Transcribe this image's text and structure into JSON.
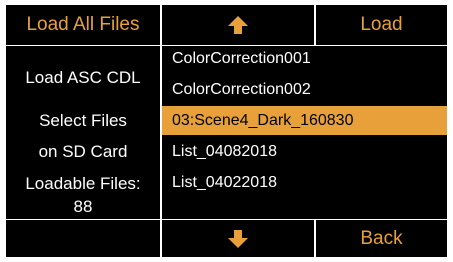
{
  "top_bar": {
    "load_all_label": "Load All Files",
    "up_icon": "arrow-up-icon",
    "load_label": "Load"
  },
  "info": {
    "title": "Load ASC CDL",
    "select_line1": "Select Files",
    "select_line2": "on SD Card",
    "loadable_label": "Loadable Files:",
    "loadable_count": "88"
  },
  "file_list": {
    "items": [
      "ColorCorrection001",
      "ColorCorrection002",
      "03:Scene4_Dark_160830",
      "List_04082018",
      "List_04022018"
    ],
    "selected_index": 2
  },
  "bottom_bar": {
    "down_icon": "arrow-down-icon",
    "back_label": "Back"
  },
  "colors": {
    "accent": "#e8a13a",
    "background": "#000000",
    "divider": "#ffffff"
  }
}
